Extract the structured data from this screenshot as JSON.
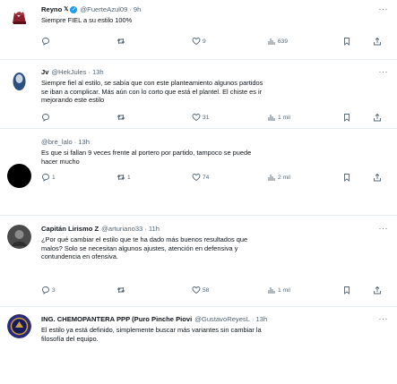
{
  "tweets": [
    {
      "name": "Reyno",
      "badge": "𝕏",
      "handle": "@FuerteAzul09",
      "time": "9h",
      "text": "Siempre FIEL a su estilo 100%",
      "replies": "",
      "retweets": "",
      "likes": "9",
      "views": "639"
    },
    {
      "name": "Jv",
      "handle": "@HekJules",
      "time": "13h",
      "text": "Siempre fiel al estilo, se sabía que con este planteamiento algunos partidos\nse iban a complicar. Más aún con lo corto que está el plantel. El chiste es ir\nmejorando este estilo",
      "replies": "",
      "retweets": "",
      "likes": "31",
      "views": "1 mil"
    },
    {
      "name": "",
      "handle": "@bre_lalo",
      "time": "13h",
      "text": "Es que si fallan 9 veces frente al portero por partido, tampoco se puede\nhacer mucho",
      "replies": "1",
      "retweets": "1",
      "likes": "74",
      "views": "2 mil"
    },
    {
      "name": "Capitán Lirismo Z",
      "handle": "@arturiano33",
      "time": "11h",
      "text": "¿Por qué cambiar el estilo que te ha dado más buenos resultados que\nmalos? Solo se necesitan algunos ajustes, atención en defensiva y\ncontundencia en ofensiva.",
      "replies": "3",
      "retweets": "",
      "likes": "58",
      "views": "1 mil"
    },
    {
      "name": "ING. CHEMOPANTERA PPP (Puro Pinche Piovi",
      "handle": "@GustavoReyesL",
      "time": "13h",
      "text": "El estilo ya está definido, simplemente buscar más variantes sin cambiar la\nfilosofía del equipo."
    }
  ],
  "icons": {
    "reply": "reply-icon",
    "retweet": "retweet-icon",
    "like": "heart-icon",
    "views": "views-icon",
    "bookmark": "bookmark-icon",
    "share": "share-icon",
    "more": "more-icon",
    "verified": "verified-icon"
  },
  "colors": {
    "text": "#0f1419",
    "secondary": "#536471",
    "divider": "#e6ecf0",
    "verified": "#1d9bf0"
  }
}
